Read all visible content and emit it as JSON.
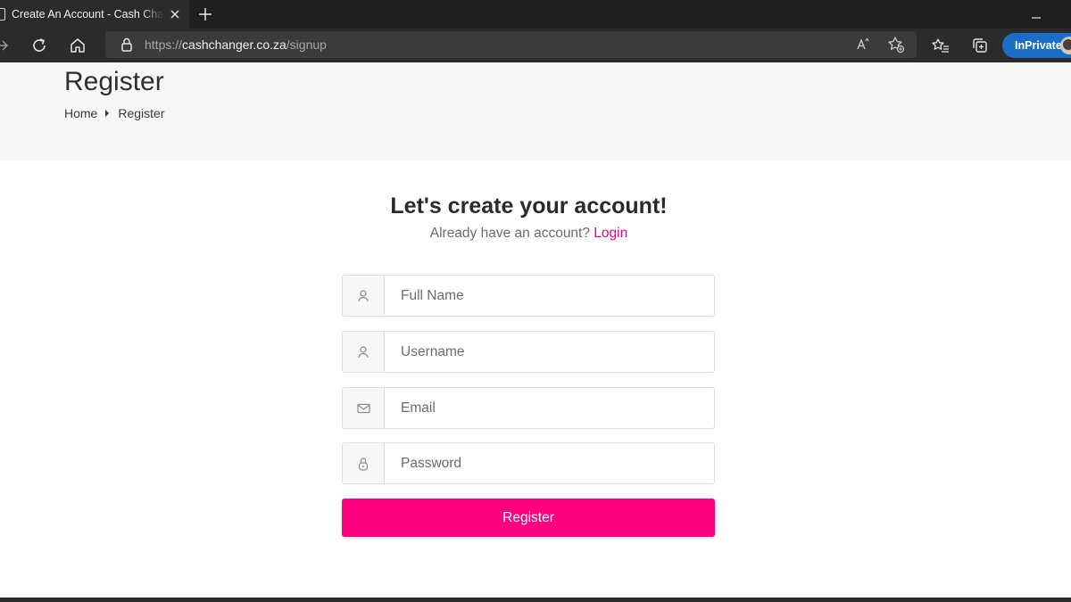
{
  "browser": {
    "tab": {
      "title": "Create An Account - Cash Changer"
    },
    "address": {
      "scheme": "https://",
      "host": "cashchanger.co.za",
      "path": "/signup"
    },
    "inprivate_label": "InPrivate"
  },
  "header": {
    "title": "Register",
    "breadcrumb": [
      {
        "label": "Home"
      },
      {
        "label": "Register"
      }
    ]
  },
  "form": {
    "heading": "Let's create your account!",
    "subheading": "Already have an account?",
    "login_link": "Login",
    "fields": [
      {
        "placeholder": "Full Name",
        "icon": "user-icon"
      },
      {
        "placeholder": "Username",
        "icon": "user-icon"
      },
      {
        "placeholder": "Email",
        "icon": "envelope-icon"
      },
      {
        "placeholder": "Password",
        "icon": "lock-icon"
      }
    ],
    "submit_label": "Register"
  },
  "colors": {
    "accent": "#ff0080",
    "link": "#e6007e",
    "header_bg": "#f7f7f7",
    "inprivate_badge": "#1a6ec8"
  }
}
